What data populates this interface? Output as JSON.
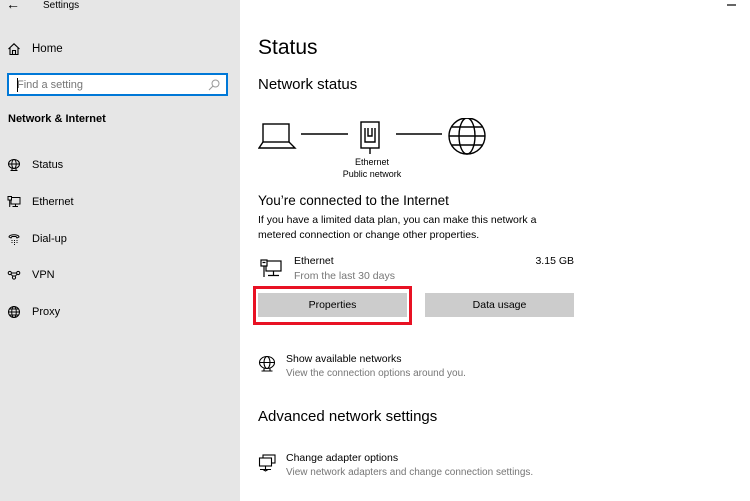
{
  "window": {
    "title": "Settings",
    "back_icon": "back-arrow-icon",
    "minimize_icon": "minimize-icon"
  },
  "sidebar": {
    "home_label": "Home",
    "home_icon": "home-icon",
    "search": {
      "placeholder": "Find a setting",
      "value": "",
      "icon": "search-icon"
    },
    "section_title": "Network & Internet",
    "items": [
      {
        "label": "Status",
        "icon": "status-globe-icon"
      },
      {
        "label": "Ethernet",
        "icon": "ethernet-icon"
      },
      {
        "label": "Dial-up",
        "icon": "dialup-phone-icon"
      },
      {
        "label": "VPN",
        "icon": "vpn-icon"
      },
      {
        "label": "Proxy",
        "icon": "proxy-globe-icon"
      }
    ]
  },
  "main": {
    "page_title": "Status",
    "network_status_heading": "Network status",
    "diagram": {
      "device_icon": "laptop-icon",
      "adapter_icon": "ethernet-port-icon",
      "internet_icon": "globe-icon",
      "adapter_name": "Ethernet",
      "network_type": "Public network"
    },
    "connected_heading": "You’re connected to the Internet",
    "connected_desc": "If you have a limited data plan, you can make this network a metered connection or change other properties.",
    "connection": {
      "name": "Ethernet",
      "period": "From the last 30 days",
      "usage": "3.15 GB",
      "icon": "ethernet-icon"
    },
    "buttons": {
      "properties": "Properties",
      "data_usage": "Data usage"
    },
    "highlight_color": "#e81123",
    "show_networks": {
      "title": "Show available networks",
      "subtitle": "View the connection options around you.",
      "icon": "networks-globe-icon"
    },
    "advanced_heading": "Advanced network settings",
    "adapter_options": {
      "title": "Change adapter options",
      "subtitle": "View network adapters and change connection settings.",
      "icon": "adapter-icon"
    }
  },
  "colors": {
    "sidebar_bg": "#e6e6e6",
    "accent": "#0078d7",
    "button_bg": "#cccccc",
    "secondary_text": "#767676"
  }
}
